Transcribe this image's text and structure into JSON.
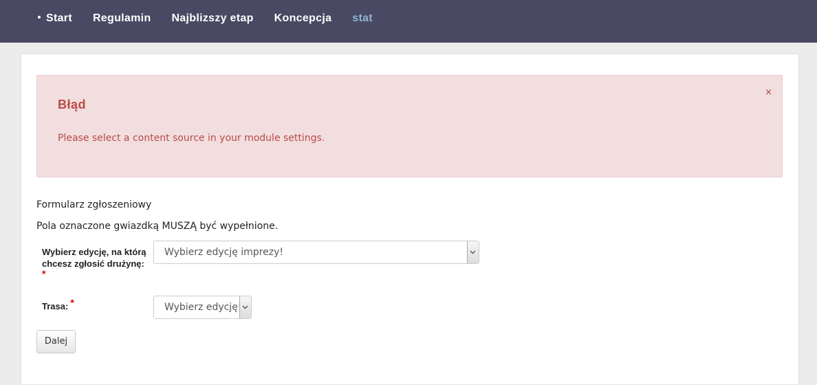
{
  "nav": {
    "items": [
      {
        "label": "Start"
      },
      {
        "label": "Regulamin"
      },
      {
        "label": "Najblizszy etap"
      },
      {
        "label": "Koncepcja"
      },
      {
        "label": "stat"
      }
    ]
  },
  "alert": {
    "heading": "Błąd",
    "message": "Please select a content source in your module settings.",
    "close_label": "×"
  },
  "form": {
    "title": "Formularz zgłoszeniowy",
    "note": "Pola oznaczone gwiazdką MUSZĄ być wypełnione.",
    "edition": {
      "label_line1": "Wybierz edycję, na którą",
      "label_line2": "chcesz zgłosić drużynę:",
      "required_mark": "*",
      "selected": "Wybierz edycję imprezy!"
    },
    "route": {
      "label": "Trasa:",
      "required_mark": "*",
      "selected": "Wybierz edycję!"
    },
    "submit_label": "Dalej"
  },
  "colors": {
    "nav_bg": "#4a4963",
    "alert_bg": "#f2dede",
    "alert_text": "#b94a48",
    "required": "#e00000"
  }
}
